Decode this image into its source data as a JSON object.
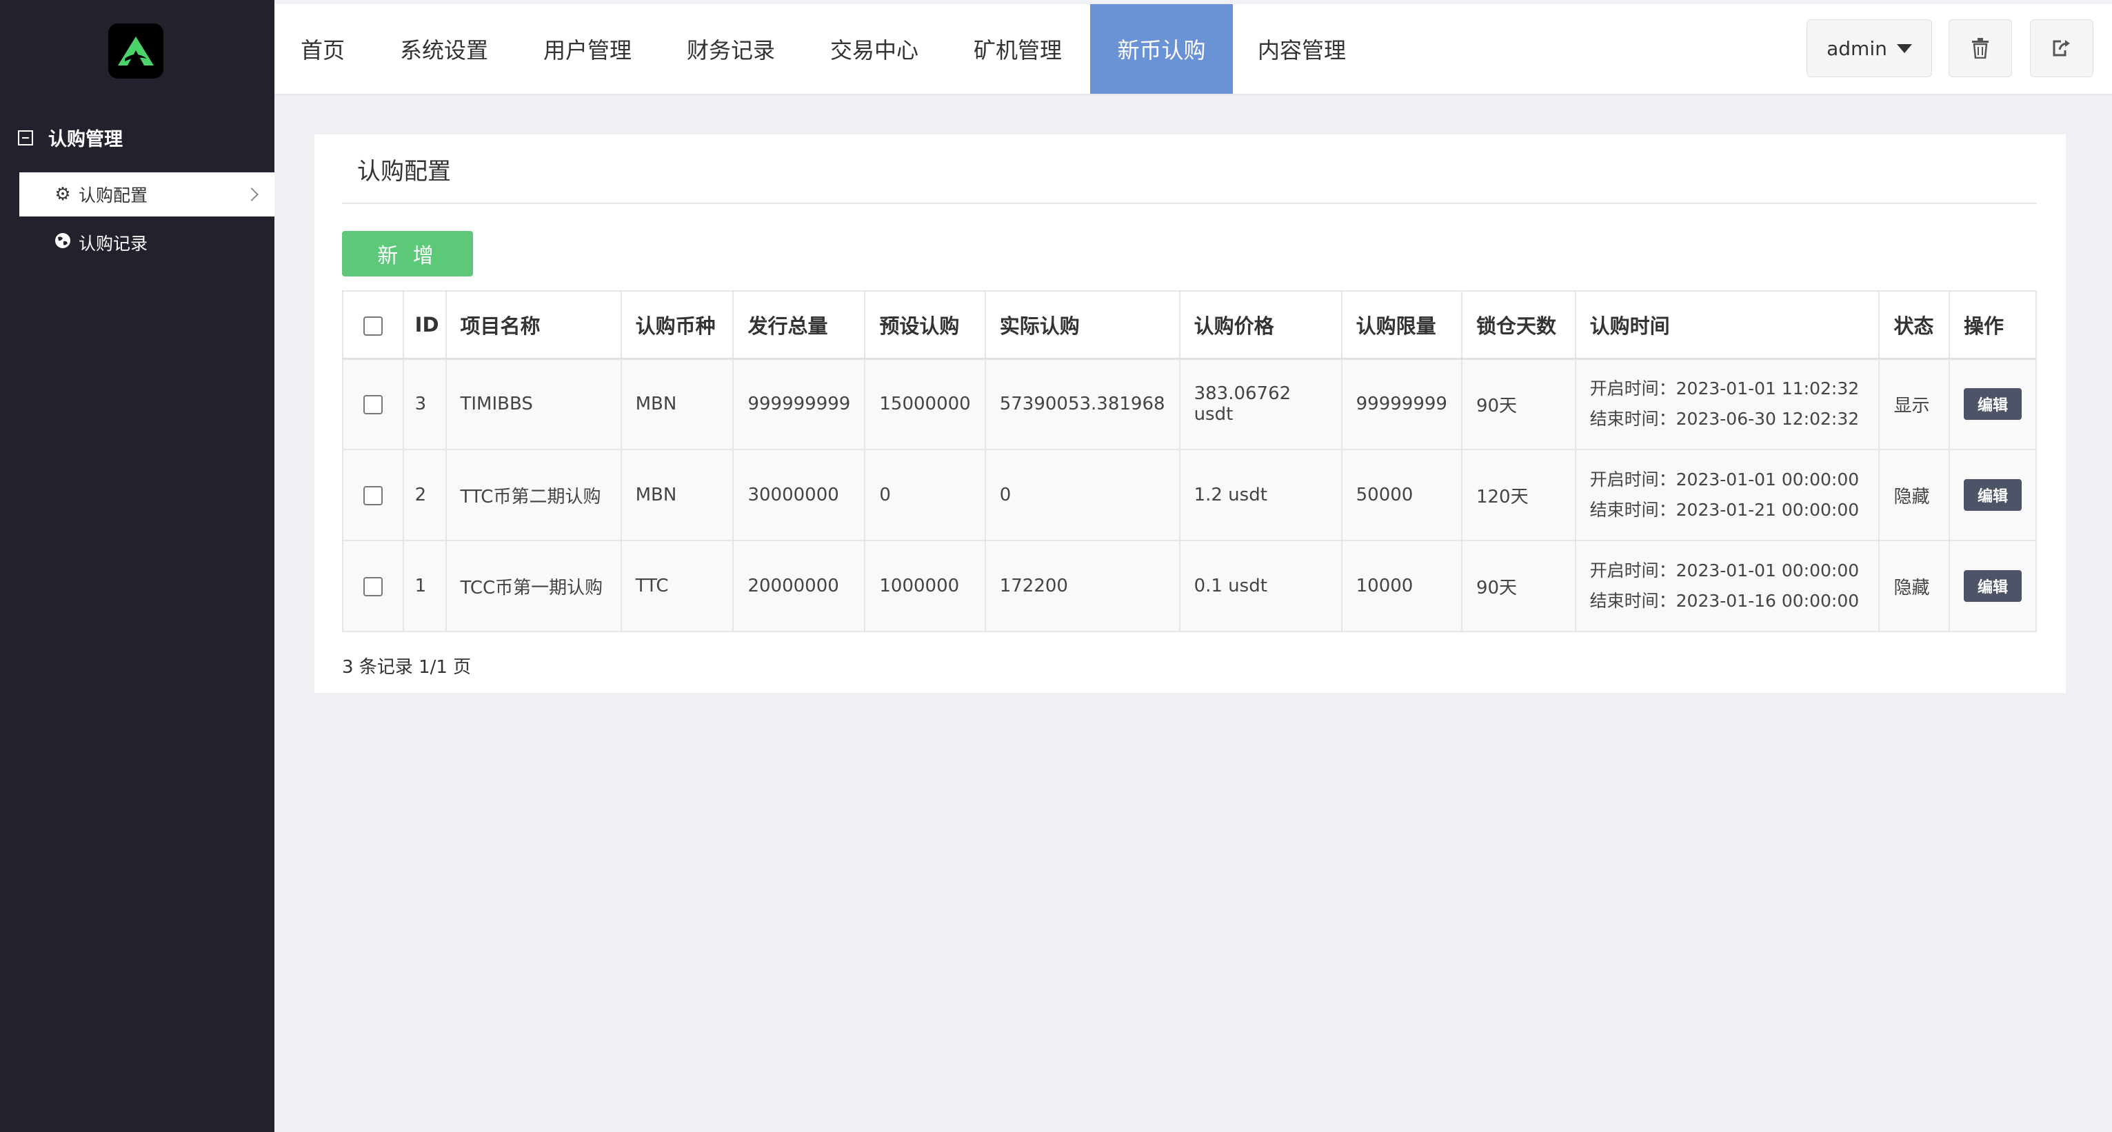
{
  "sidebar": {
    "section_title": "认购管理",
    "items": [
      {
        "label": "认购配置",
        "icon": "gear-icon",
        "active": true
      },
      {
        "label": "认购记录",
        "icon": "globe-icon",
        "active": false
      }
    ]
  },
  "nav": {
    "tabs": [
      {
        "label": "首页"
      },
      {
        "label": "系统设置"
      },
      {
        "label": "用户管理"
      },
      {
        "label": "财务记录"
      },
      {
        "label": "交易中心"
      },
      {
        "label": "矿机管理"
      },
      {
        "label": "新币认购",
        "active": true
      },
      {
        "label": "内容管理"
      }
    ],
    "user_label": "admin"
  },
  "panel": {
    "title": "认购配置",
    "add_label": "新 增",
    "record_info": "3 条记录 1/1 页"
  },
  "table": {
    "headers": [
      "ID",
      "项目名称",
      "认购币种",
      "发行总量",
      "预设认购",
      "实际认购",
      "认购价格",
      "认购限量",
      "锁仓天数",
      "认购时间",
      "状态",
      "操作"
    ],
    "rows": [
      {
        "id": "3",
        "name": "TIMIBBS",
        "coin": "MBN",
        "total": "999999999",
        "preset": "15000000",
        "actual": "57390053.381968",
        "price": "383.06762 usdt",
        "limit": "99999999",
        "lock_days": "90天",
        "start": "开启时间：2023-01-01 11:02:32",
        "end": "结束时间：2023-06-30 12:02:32",
        "status": "显示",
        "action": "编辑"
      },
      {
        "id": "2",
        "name": "TTC币第二期认购",
        "coin": "MBN",
        "total": "30000000",
        "preset": "0",
        "actual": "0",
        "price": "1.2 usdt",
        "limit": "50000",
        "lock_days": "120天",
        "start": "开启时间：2023-01-01 00:00:00",
        "end": "结束时间：2023-01-21 00:00:00",
        "status": "隐藏",
        "action": "编辑"
      },
      {
        "id": "1",
        "name": "TCC币第一期认购",
        "coin": "TTC",
        "total": "20000000",
        "preset": "1000000",
        "actual": "172200",
        "price": "0.1 usdt",
        "limit": "10000",
        "lock_days": "90天",
        "start": "开启时间：2023-01-01 00:00:00",
        "end": "结束时间：2023-01-16 00:00:00",
        "status": "隐藏",
        "action": "编辑"
      }
    ]
  },
  "colors": {
    "sidebar_bg": "#22212c",
    "nav_active": "#6a93d6",
    "add_button": "#5cc878",
    "edit_button": "#4d5467",
    "page_bg": "#f0f1f5"
  }
}
